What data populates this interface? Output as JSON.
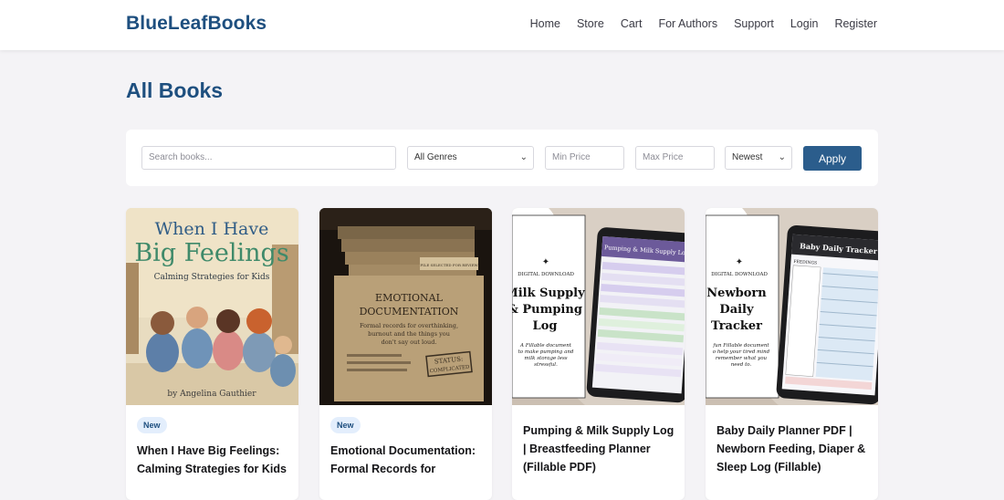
{
  "header": {
    "brand": "BlueLeafBooks",
    "nav": [
      "Home",
      "Store",
      "Cart",
      "For Authors",
      "Support",
      "Login",
      "Register"
    ]
  },
  "page": {
    "title": "All Books"
  },
  "filters": {
    "search_placeholder": "Search books...",
    "genre_selected": "All Genres",
    "min_price_placeholder": "Min Price",
    "max_price_placeholder": "Max Price",
    "sort_selected": "Newest",
    "apply_label": "Apply"
  },
  "books": [
    {
      "badge": "New",
      "title": "When I Have Big Feelings: Calming Strategies for Kids",
      "cover": {
        "line1": "When I Have",
        "line2": "Big Feelings",
        "subtitle": "Calming Strategies for Kids",
        "author": "by Angelina Gauthier"
      }
    },
    {
      "badge": "New",
      "title": "Emotional Documentation: Formal Records for",
      "cover": {
        "heading1": "EMOTIONAL",
        "heading2": "DOCUMENTATION",
        "sub1": "Formal records for overthinking,",
        "sub2": "burnout and the things you",
        "sub3": "don't say out loud.",
        "stamp1": "STATUS:",
        "stamp2": "COMPLICATED",
        "tab": "FILE SELECTED FOR REVIEW"
      }
    },
    {
      "badge": "",
      "title": "Pumping & Milk Supply Log | Breastfeeding Planner (Fillable PDF)",
      "cover": {
        "tag": "DIGITAL DOWNLOAD",
        "t1": "Milk Supply",
        "t2": "& Pumping",
        "t3": "Log",
        "d1": "A Fillable document",
        "d2": "to make pumping and",
        "d3": "milk storage less",
        "d4": "stressful.",
        "screen": "Pumping & Milk Supply Log"
      }
    },
    {
      "badge": "",
      "title": "Baby Daily Planner PDF | Newborn Feeding, Diaper & Sleep Log (Fillable)",
      "cover": {
        "tag": "DIGITAL DOWNLOAD",
        "t1": "Newborn",
        "t2": "Daily",
        "t3": "Tracker",
        "d1": "fun Fillable document",
        "d2": "o help your tired mind",
        "d3": "remember what you",
        "d4": "need to.",
        "screen": "Baby Daily Tracker",
        "col": "FEEDINGS"
      }
    }
  ],
  "colors": {
    "brand": "#1e4f7f",
    "button": "#2b5d8c",
    "badge_bg": "#e3eefc"
  },
  "icons": {
    "select_chevron": "chevron-down-icon"
  }
}
